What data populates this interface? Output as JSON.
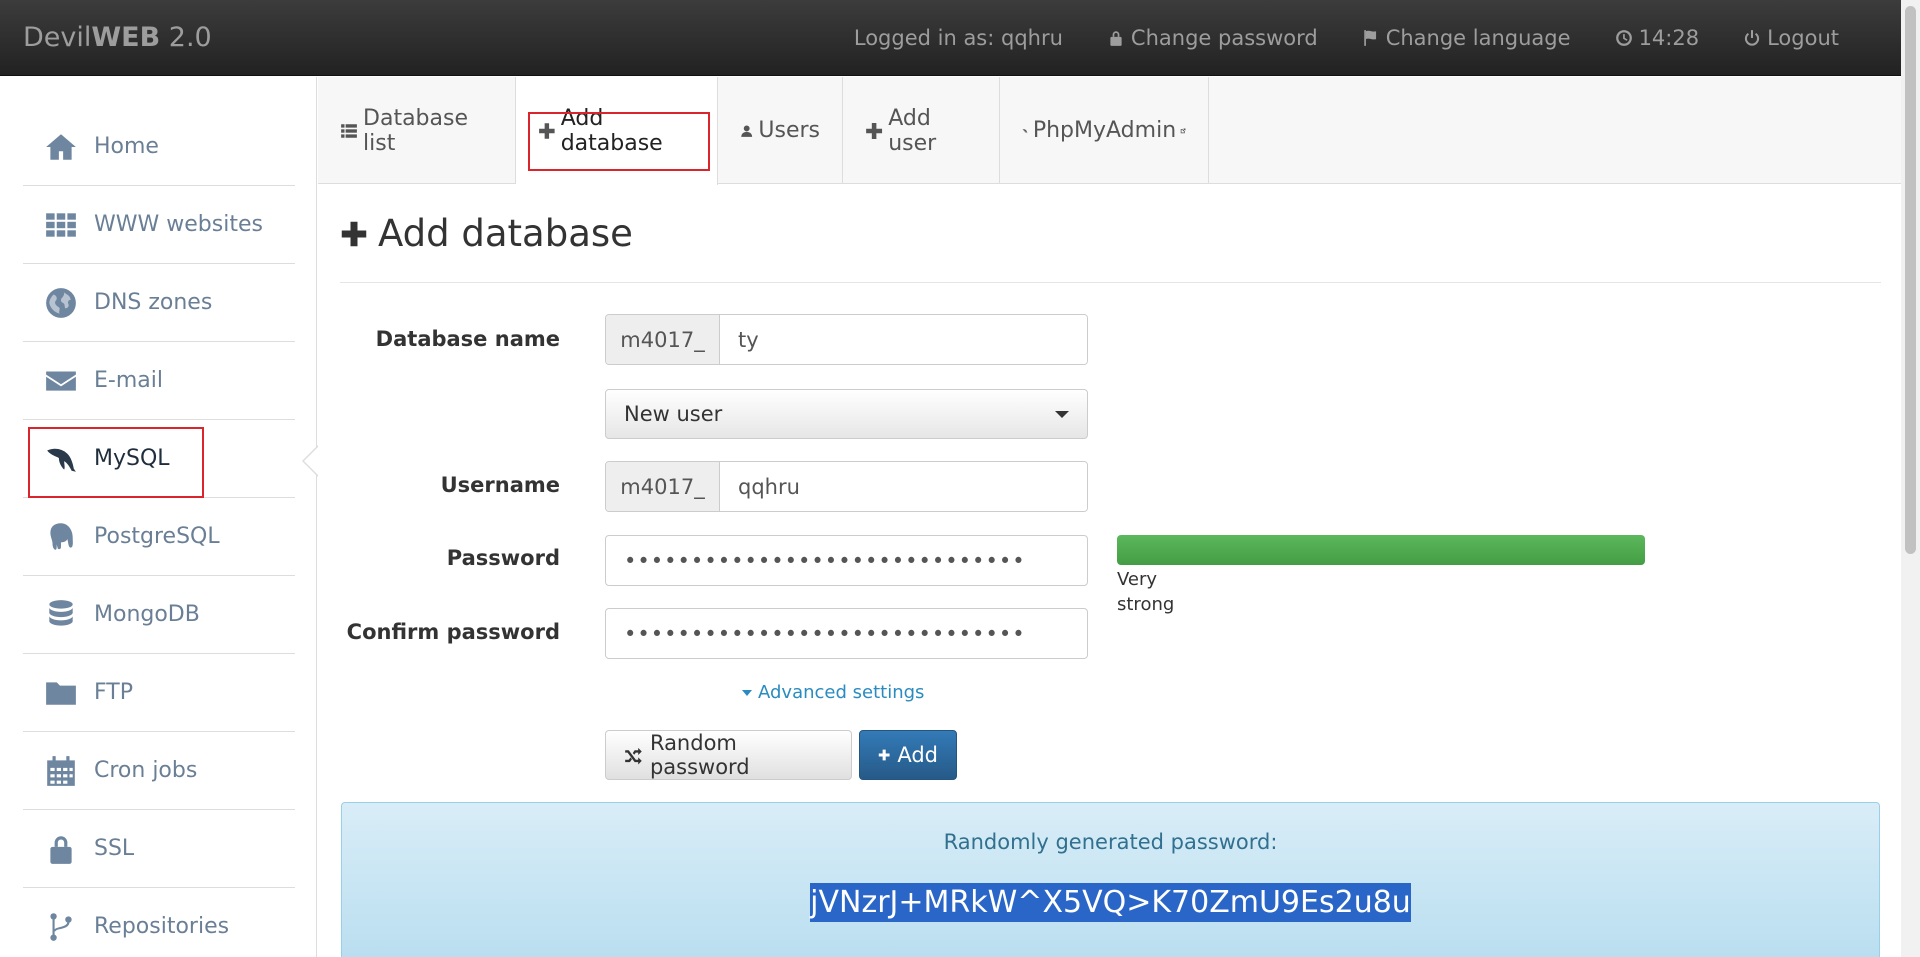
{
  "topbar": {
    "brand_prefix": "Devil",
    "brand_bold": "WEB",
    "brand_suffix": " 2.0",
    "logged_in": "Logged in as: qqhru",
    "change_password": "Change password",
    "change_language": "Change language",
    "time": "14:28",
    "logout": "Logout"
  },
  "sidebar": {
    "items": [
      {
        "label": "Home",
        "icon": "home-icon"
      },
      {
        "label": "WWW websites",
        "icon": "grid-icon"
      },
      {
        "label": "DNS zones",
        "icon": "globe-icon"
      },
      {
        "label": "E-mail",
        "icon": "envelope-icon"
      },
      {
        "label": "MySQL",
        "icon": "dolphin-icon",
        "active": true
      },
      {
        "label": "PostgreSQL",
        "icon": "elephant-icon"
      },
      {
        "label": "MongoDB",
        "icon": "database-icon"
      },
      {
        "label": "FTP",
        "icon": "folder-icon"
      },
      {
        "label": "Cron jobs",
        "icon": "calendar-icon"
      },
      {
        "label": "SSL",
        "icon": "lock-icon"
      },
      {
        "label": "Repositories",
        "icon": "branch-icon"
      }
    ]
  },
  "tabs": [
    {
      "label": "Database list",
      "icon": "list-icon"
    },
    {
      "label": "Add database",
      "icon": "plus-icon",
      "active": true
    },
    {
      "label": "Users",
      "icon": "user-icon"
    },
    {
      "label": "Add user",
      "icon": "plus-icon"
    },
    {
      "label": "PhpMyAdmin",
      "icon": "dolphin-icon"
    }
  ],
  "form": {
    "title": "Add database",
    "db_name_label": "Database name",
    "db_prefix": "m4017_",
    "db_name_value": "ty",
    "user_select": "New user",
    "username_label": "Username",
    "username_prefix": "m4017_",
    "username_value": "qqhru",
    "password_label": "Password",
    "password_mask": "••••••••••••••••••••••••••••••",
    "confirm_label": "Confirm password",
    "confirm_mask": "••••••••••••••••••••••••••••••",
    "strength_level": 1.0,
    "strength_text": "Very strong",
    "strength_color": "#5cb85c",
    "advanced": "Advanced settings",
    "random_btn": "Random password",
    "add_btn": "Add"
  },
  "generated": {
    "title": "Randomly generated password:",
    "password": "jVNzrJ+MRkW^X5VQ>K70ZmU9Es2u8u"
  },
  "colors": {
    "highlight": "#d9252b",
    "primary": "#337ab7",
    "link": "#2a8bc0"
  }
}
